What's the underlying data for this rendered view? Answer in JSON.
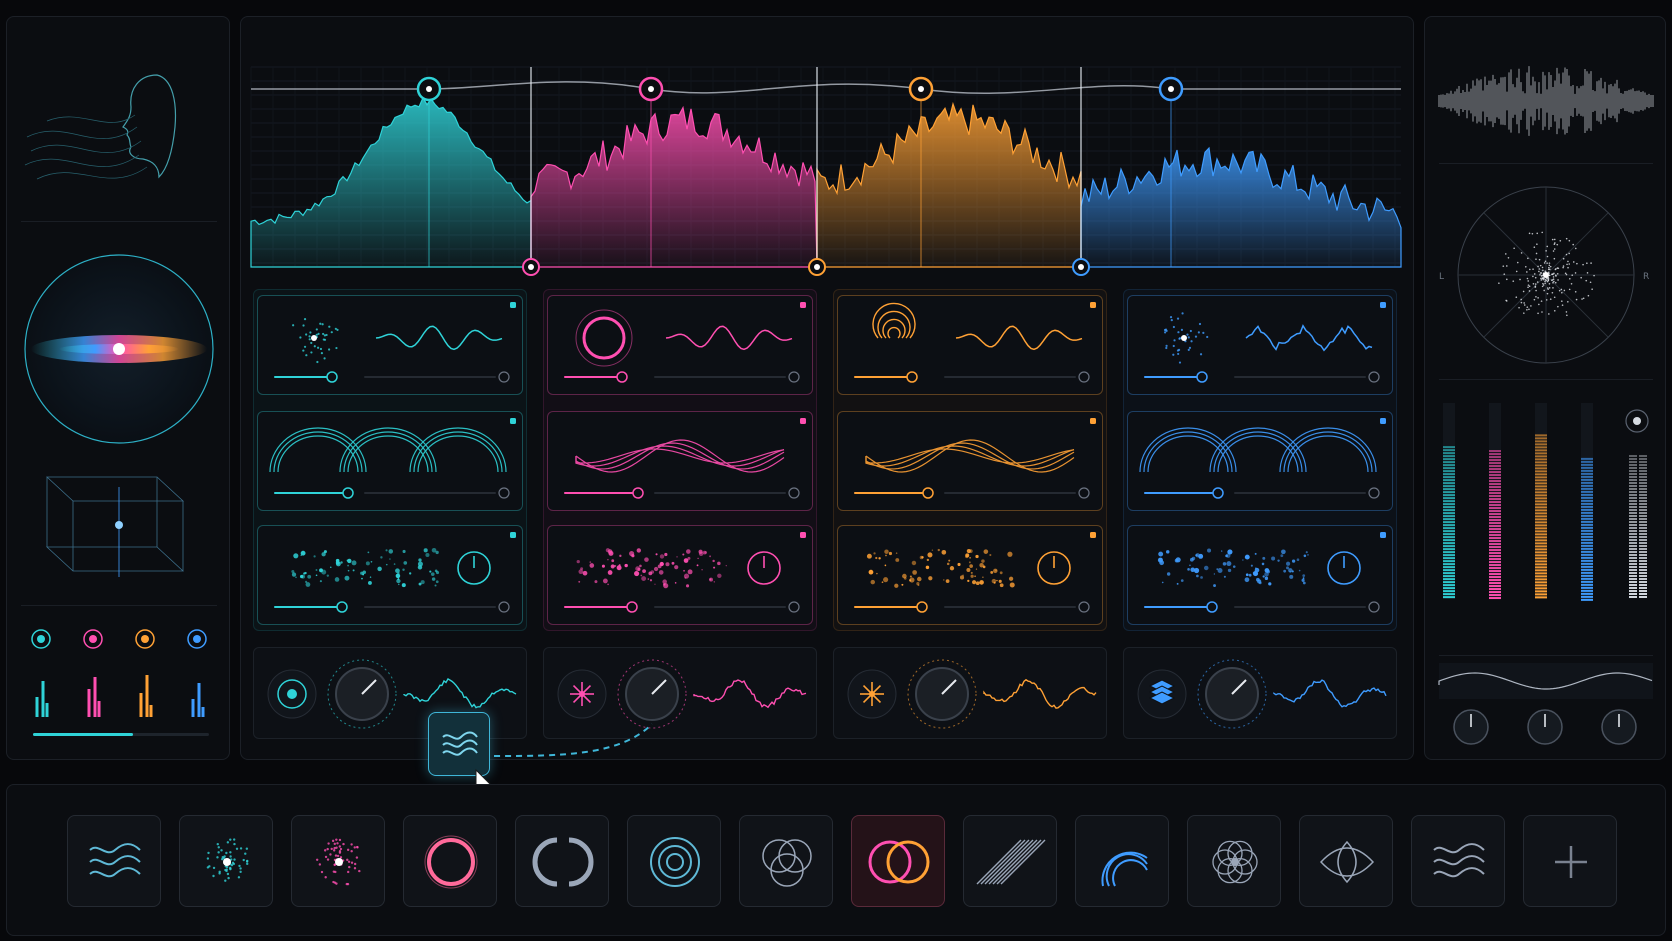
{
  "accents": {
    "cyan": "#2fd3d8",
    "magenta": "#ff4fb1",
    "orange": "#ffa135",
    "blue": "#3f9cff"
  },
  "bands": [
    {
      "name": "band-1",
      "color": "#2fd3d8",
      "icon": "pulse-target-icon"
    },
    {
      "name": "band-2",
      "color": "#ff4fb1",
      "icon": "starburst-icon"
    },
    {
      "name": "band-3",
      "color": "#ffa135",
      "icon": "sun-icon"
    },
    {
      "name": "band-4",
      "color": "#3f9cff",
      "icon": "layers-icon"
    }
  ],
  "meters": {
    "stereo_left_label": "L",
    "stereo_right_label": "R"
  },
  "tray": {
    "items": [
      {
        "icon": "waves-icon",
        "accent": "#5fb9d6"
      },
      {
        "icon": "particle-burst-icon",
        "accent": "#2fd3d8"
      },
      {
        "icon": "glow-orb-icon",
        "accent": "#ff4fb1"
      },
      {
        "icon": "ring-icon",
        "accent": "#ff6a9a"
      },
      {
        "icon": "split-ring-icon",
        "accent": "#9aa6b8"
      },
      {
        "icon": "concentric-rings-icon",
        "accent": "#5fb9d6"
      },
      {
        "icon": "venn-icon",
        "accent": "#9aa6b8"
      },
      {
        "icon": "dual-circles-icon",
        "accent": "#ff4fb1",
        "selected": true
      },
      {
        "icon": "diagonal-lines-icon",
        "accent": "#9aa6b8"
      },
      {
        "icon": "arc-icon",
        "accent": "#3f9cff"
      },
      {
        "icon": "flower-icon",
        "accent": "#9aa6b8"
      },
      {
        "icon": "lens-icon",
        "accent": "#9aa6b8"
      },
      {
        "icon": "wavy-lines-icon",
        "accent": "#9aa6b8"
      },
      {
        "icon": "plus-icon",
        "accent": "#7a8290"
      }
    ]
  }
}
